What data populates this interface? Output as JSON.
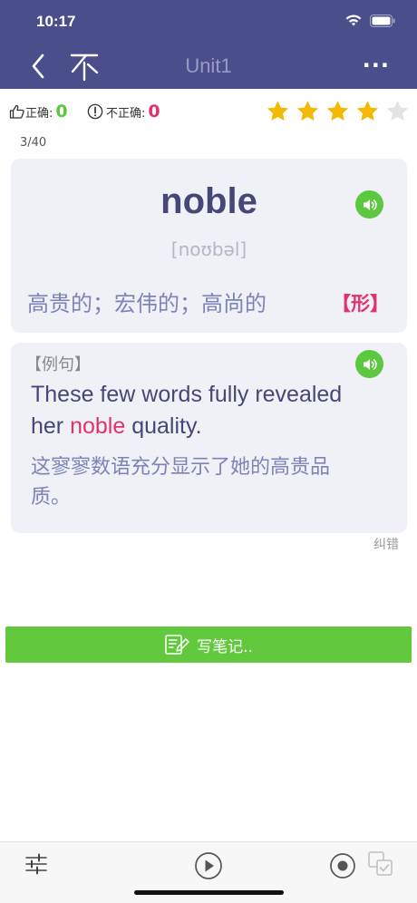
{
  "status": {
    "time": "10:17"
  },
  "nav": {
    "title": "Unit1",
    "more": "···"
  },
  "score": {
    "correct_label": "正确:",
    "correct_value": "0",
    "wrong_label": "不正确:",
    "wrong_value": "0"
  },
  "rating": {
    "stars": 4,
    "max": 5
  },
  "progress": {
    "text": "3/40"
  },
  "word_card": {
    "word": "noble",
    "phonetic": "[noʊbəl]",
    "meaning": "高贵的；宏伟的；高尚的",
    "pos": "【形】"
  },
  "example": {
    "label": "【例句】",
    "en_before": "These few words fully revealed her ",
    "en_highlight": "noble",
    "en_after": " quality.",
    "zh": "这寥寥数语充分显示了她的高贵品质。"
  },
  "report": {
    "label": "纠错"
  },
  "note_button": {
    "label": "写笔记.."
  },
  "colors": {
    "header": "#4a4e8a",
    "accent_green": "#62c93f",
    "highlight": "#e0336e",
    "star_on": "#f5b800",
    "star_off": "#e3e3e6",
    "correct": "#5cc83f",
    "wrong": "#e0336e"
  }
}
